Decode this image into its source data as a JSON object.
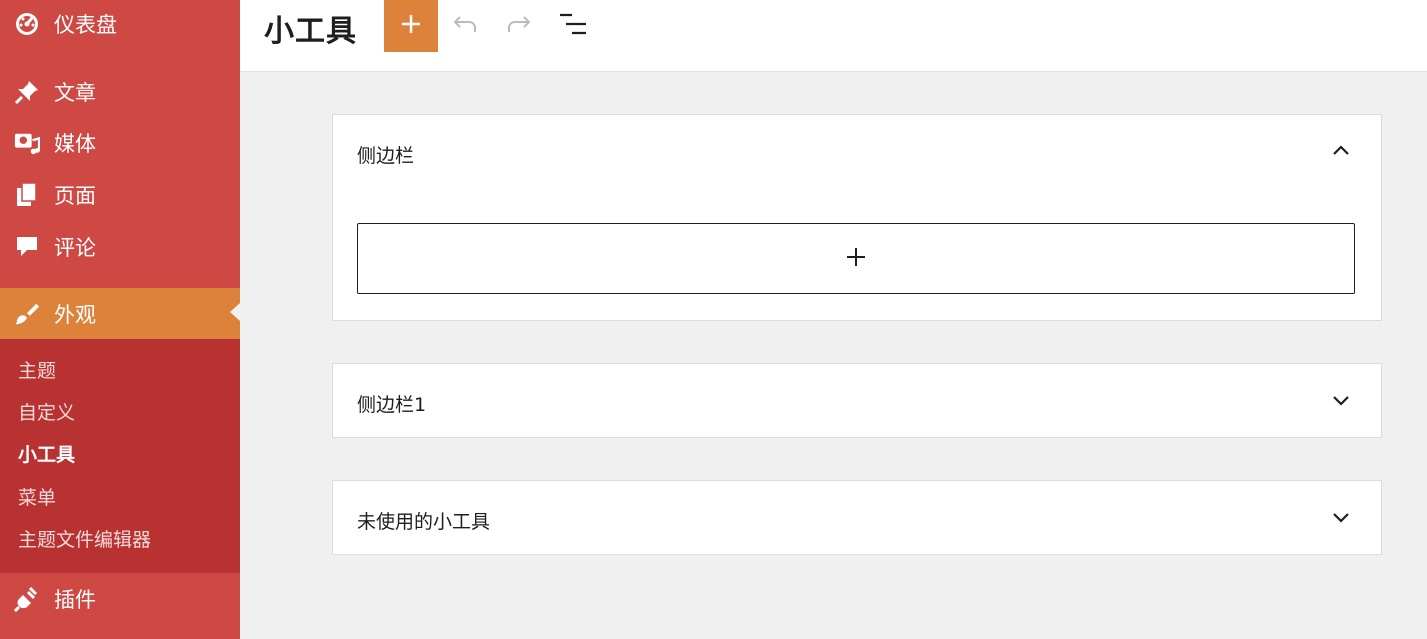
{
  "sidebar": {
    "items": [
      {
        "label": "仪表盘",
        "icon": "dashboard-icon"
      },
      {
        "label": "文章",
        "icon": "pin-icon"
      },
      {
        "label": "媒体",
        "icon": "media-icon"
      },
      {
        "label": "页面",
        "icon": "pages-icon"
      },
      {
        "label": "评论",
        "icon": "comment-icon"
      },
      {
        "label": "外观",
        "icon": "appearance-brush-icon",
        "active": true
      },
      {
        "label": "插件",
        "icon": "plugins-icon"
      }
    ],
    "submenu": [
      "主题",
      "自定义",
      "小工具",
      "菜单",
      "主题文件编辑器"
    ],
    "submenu_current": "小工具"
  },
  "header": {
    "title": "小工具",
    "add_icon": "plus-icon",
    "undo_icon": "undo-icon",
    "redo_icon": "redo-icon",
    "list_view_icon": "list-view-icon"
  },
  "panels": [
    {
      "title": "侧边栏",
      "expanded": true
    },
    {
      "title": "侧边栏1",
      "expanded": false
    },
    {
      "title": "未使用的小工具",
      "expanded": false
    }
  ],
  "colors": {
    "sidebar_bg": "#cf4944",
    "submenu_bg": "#b83232",
    "accent": "#dd823b",
    "background": "#f0f0f0"
  }
}
